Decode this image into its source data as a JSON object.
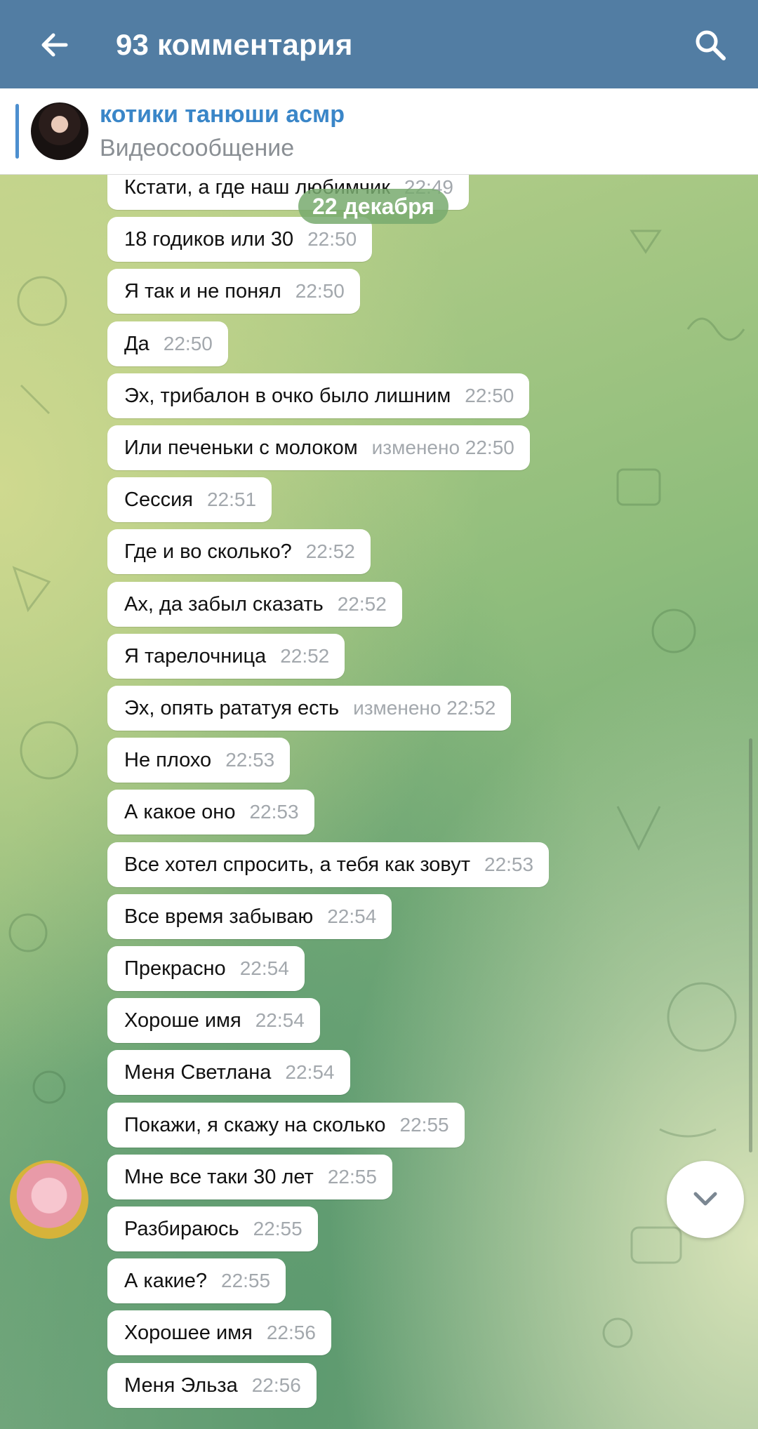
{
  "topbar": {
    "title": "93 комментария"
  },
  "pinned": {
    "channel": "котики танюши асмр",
    "type": "Видеосообщение"
  },
  "date_pill": "22 декабря",
  "messages": [
    {
      "text": "Кстати, а где наш любимчик",
      "meta": "22:49"
    },
    {
      "text": "18 годиков или 30",
      "meta": "22:50"
    },
    {
      "text": "Я так и не понял",
      "meta": "22:50"
    },
    {
      "text": "Да",
      "meta": "22:50"
    },
    {
      "text": "Эх, трибалон в очко было лишним",
      "meta": "22:50"
    },
    {
      "text": "Или печеньки с молоком",
      "meta": "изменено 22:50"
    },
    {
      "text": "Сессия",
      "meta": "22:51"
    },
    {
      "text": "Где и во сколько?",
      "meta": "22:52"
    },
    {
      "text": "Ах, да забыл сказать",
      "meta": "22:52"
    },
    {
      "text": "Я тарелочница",
      "meta": "22:52"
    },
    {
      "text": "Эх, опять рататуя есть",
      "meta": "изменено 22:52"
    },
    {
      "text": "Не плохо",
      "meta": "22:53"
    },
    {
      "text": "А какое оно",
      "meta": "22:53"
    },
    {
      "text": "Все хотел спросить, а тебя как зовут",
      "meta": "22:53"
    },
    {
      "text": "Все время забываю",
      "meta": "22:54"
    },
    {
      "text": "Прекрасно",
      "meta": "22:54"
    },
    {
      "text": "Хороше имя",
      "meta": "22:54"
    },
    {
      "text": "Меня Светлана",
      "meta": "22:54"
    },
    {
      "text": "Покажи, я скажу на сколько",
      "meta": "22:55"
    },
    {
      "text": "Мне все таки 30 лет",
      "meta": "22:55"
    },
    {
      "text": "Разбираюсь",
      "meta": "22:55"
    },
    {
      "text": "А какие?",
      "meta": "22:55"
    },
    {
      "text": "Хорошее имя",
      "meta": "22:56"
    },
    {
      "text": "Меня Эльза",
      "meta": "22:56"
    }
  ],
  "icons": {
    "back": "arrow-left-icon",
    "search": "search-icon",
    "scroll_down": "chevron-down-icon"
  },
  "colors": {
    "header": "#527da3",
    "accent": "#3a86c8",
    "bubble": "#ffffff",
    "meta_text": "#a3a8ad"
  }
}
